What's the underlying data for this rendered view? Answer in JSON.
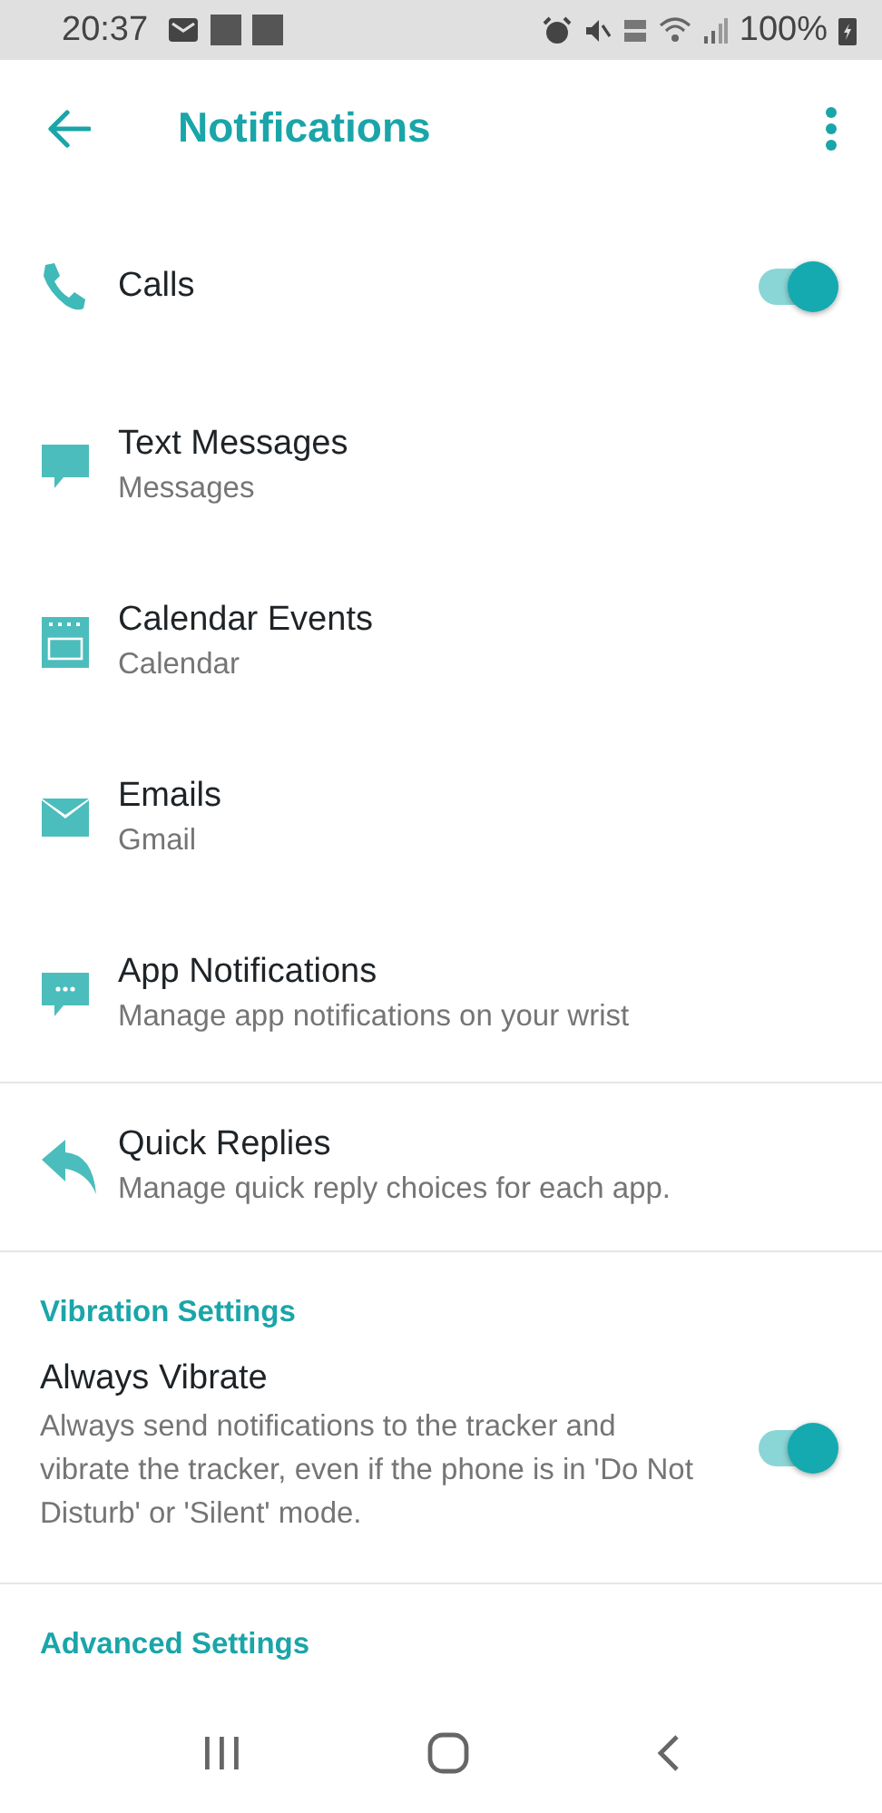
{
  "status_bar": {
    "time": "20:37",
    "battery": "100%"
  },
  "header": {
    "title": "Notifications"
  },
  "notifications": [
    {
      "title": "Calls",
      "on": true
    },
    {
      "title": "Text Messages",
      "subtitle": "Messages"
    },
    {
      "title": "Calendar Events",
      "subtitle": "Calendar"
    },
    {
      "title": "Emails",
      "subtitle": "Gmail"
    },
    {
      "title": "App Notifications",
      "subtitle": "Manage app notifications on your wrist"
    }
  ],
  "quick_replies": {
    "title": "Quick Replies",
    "subtitle": "Manage quick reply choices for each app."
  },
  "vibration_settings": {
    "heading": "Vibration Settings",
    "title": "Always Vibrate",
    "description": "Always send notifications to the tracker and vibrate the tracker, even if the phone is in 'Do Not Disturb' or 'Silent' mode.",
    "on": true
  },
  "advanced_settings": {
    "heading": "Advanced Settings"
  }
}
